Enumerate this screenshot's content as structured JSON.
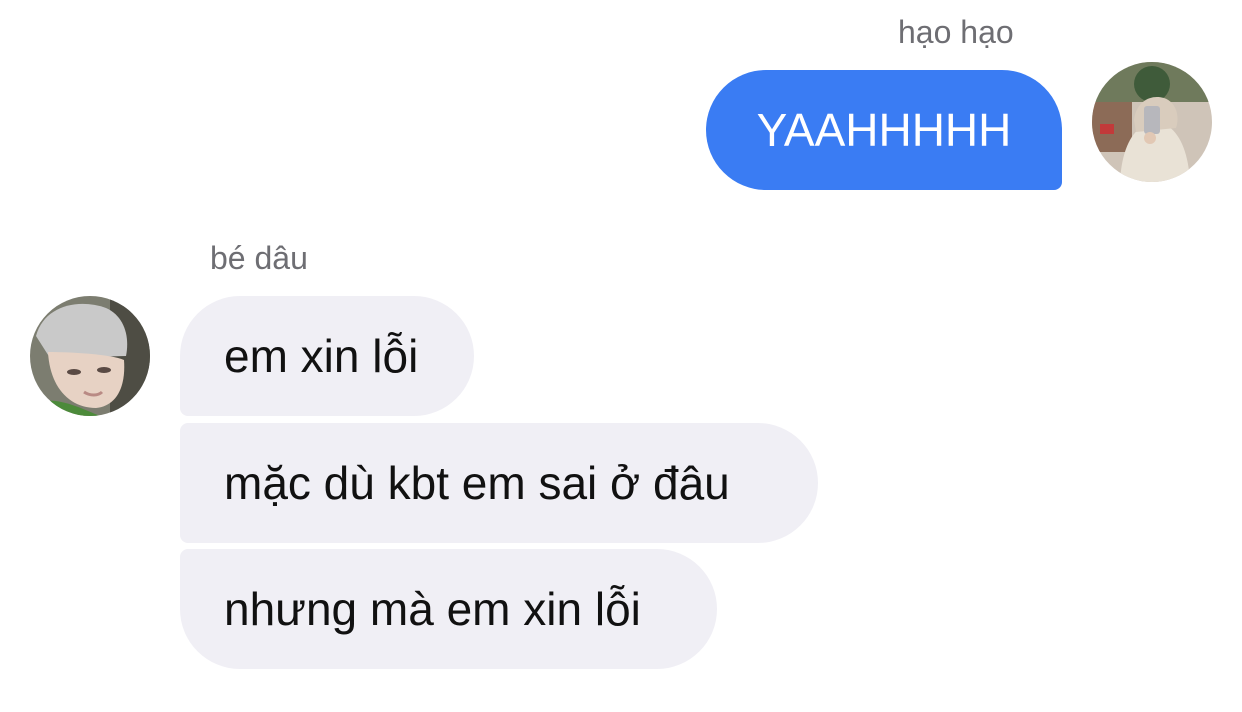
{
  "conversation": {
    "outgoing": {
      "sender_name": "hạo hạo",
      "avatar": "profile-photo-icon",
      "messages": [
        {
          "text": "YAAHHHHH"
        }
      ]
    },
    "incoming": {
      "sender_name": "bé dâu",
      "avatar": "profile-photo-icon",
      "messages": [
        {
          "text": "em xin lỗi"
        },
        {
          "text": "mặc dù kbt em sai ở đâu"
        },
        {
          "text": "nhưng mà em xin lỗi"
        }
      ]
    }
  },
  "colors": {
    "outgoing_bubble": "#3a7cf3",
    "incoming_bubble": "#f0eff5",
    "sender_label": "#6e6e73"
  }
}
